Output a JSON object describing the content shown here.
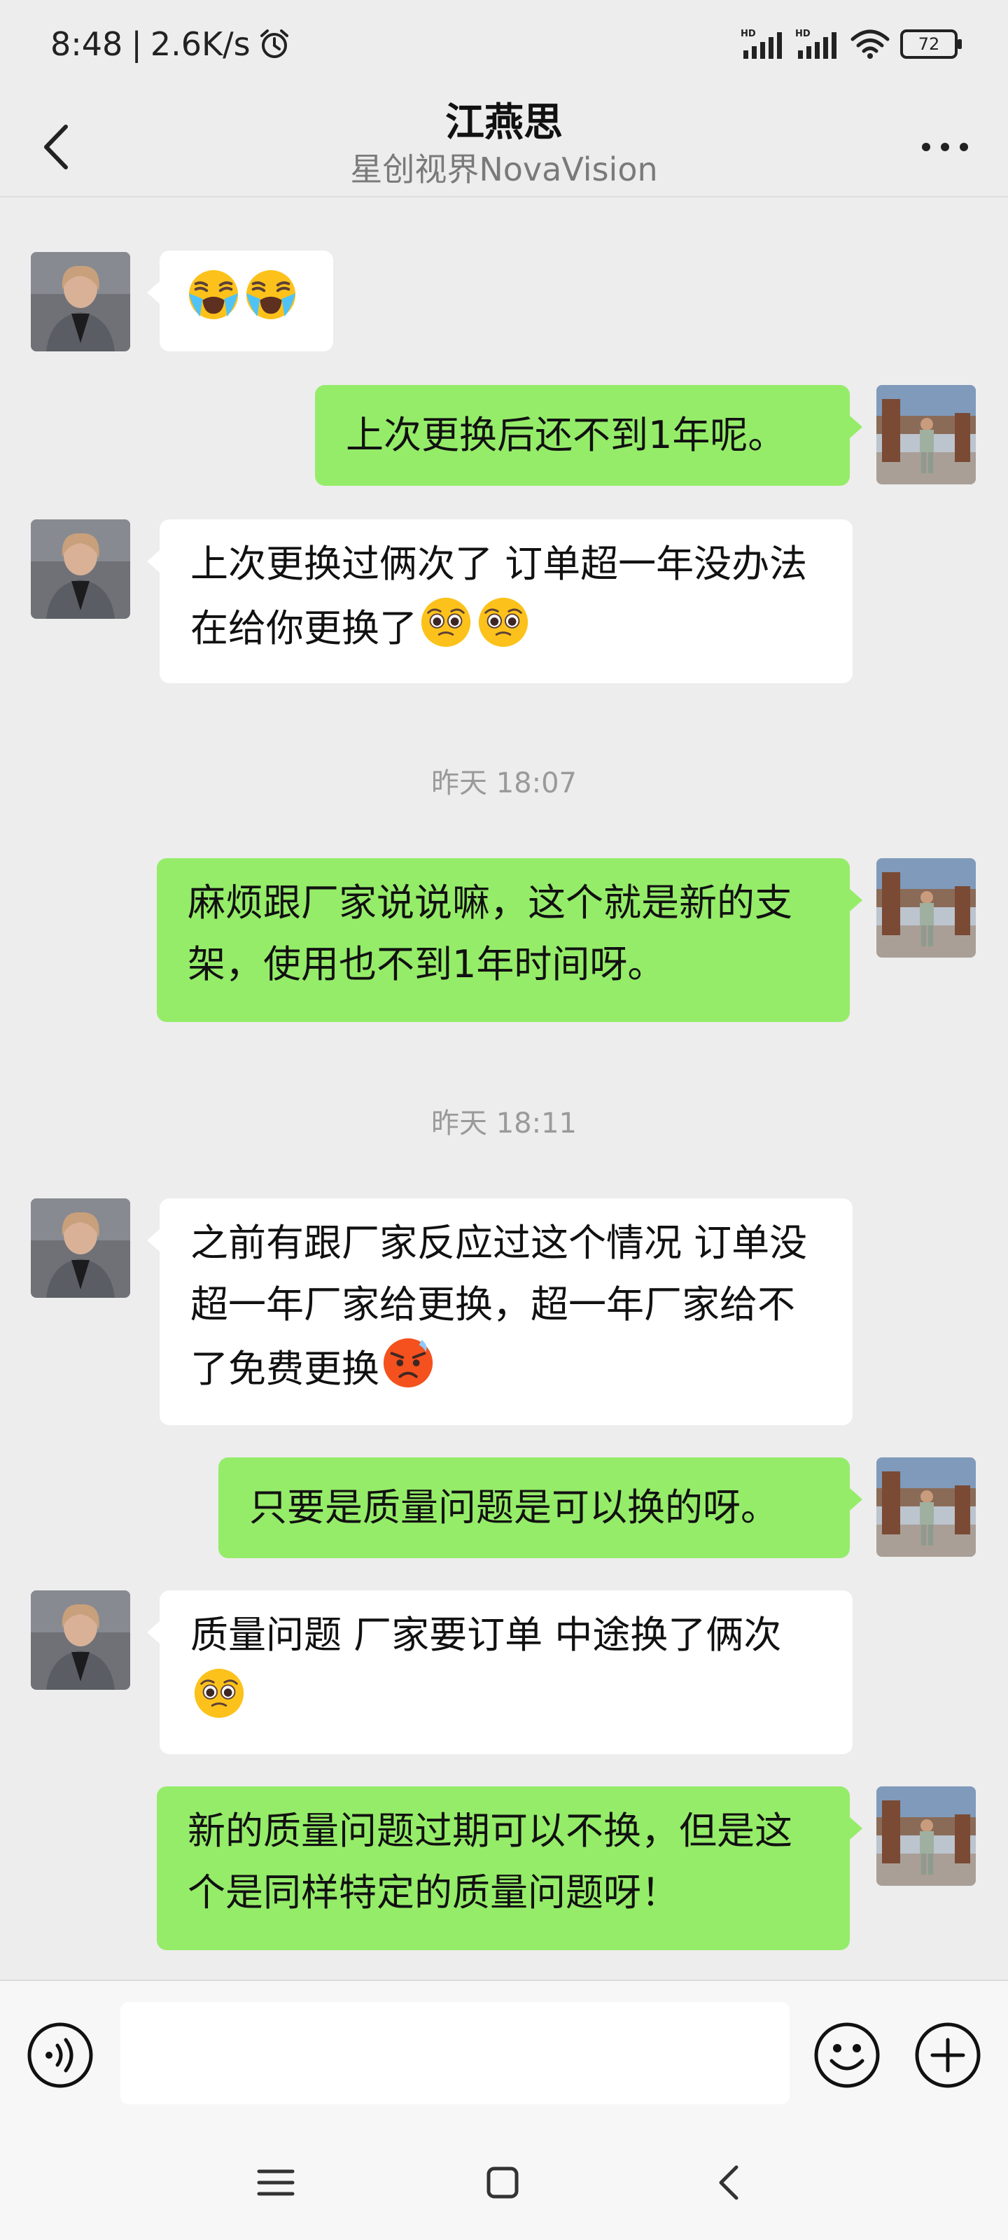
{
  "status_bar": {
    "time": "8:48",
    "separator": "|",
    "speed": "2.6K/s",
    "battery": "72",
    "icons": [
      "alarm-icon",
      "signal-icon",
      "signal-icon",
      "wifi-icon",
      "battery-icon"
    ]
  },
  "header": {
    "title": "江燕思",
    "subtitle": "星创视界NovaVision"
  },
  "messages": [
    {
      "id": 1,
      "side": "in",
      "text": "",
      "emojis": [
        "loudly-crying-face",
        "loudly-crying-face"
      ]
    },
    {
      "id": 2,
      "side": "out",
      "text": "上次更换后还不到1年呢。"
    },
    {
      "id": 3,
      "side": "in",
      "text": "上次更换过俩次了 订单超一年没办法在给你更换了",
      "emojis": [
        "pleading-face",
        "pleading-face"
      ]
    },
    {
      "id": 4,
      "side": "out",
      "text": "麻烦跟厂家说说嘛，这个就是新的支架，使用也不到1年时间呀。"
    },
    {
      "id": 5,
      "side": "in",
      "text": "之前有跟厂家反应过这个情况 订单没超一年厂家给更换，超一年厂家给不了免费更换",
      "emojis": [
        "hot-angry-face"
      ]
    },
    {
      "id": 6,
      "side": "out",
      "text": "只要是质量问题是可以换的呀。"
    },
    {
      "id": 7,
      "side": "in",
      "text": "质量问题 厂家要订单 中途换了俩次",
      "emojis": [
        "pleading-face"
      ]
    },
    {
      "id": 8,
      "side": "out",
      "text": "新的质量问题过期可以不换，但是这个是同样特定的质量问题呀！"
    }
  ],
  "timestamps": [
    "昨天 18:07",
    "昨天 18:11"
  ],
  "colors": {
    "background": "#ededed",
    "outgoing_bubble": "#95ec69",
    "incoming_bubble": "#ffffff"
  },
  "input_bar": {
    "value": "",
    "icons": [
      "voice-icon",
      "emoji-icon",
      "plus-icon"
    ]
  },
  "nav_bar": {
    "icons": [
      "menu-icon",
      "home-icon",
      "back-icon"
    ]
  }
}
